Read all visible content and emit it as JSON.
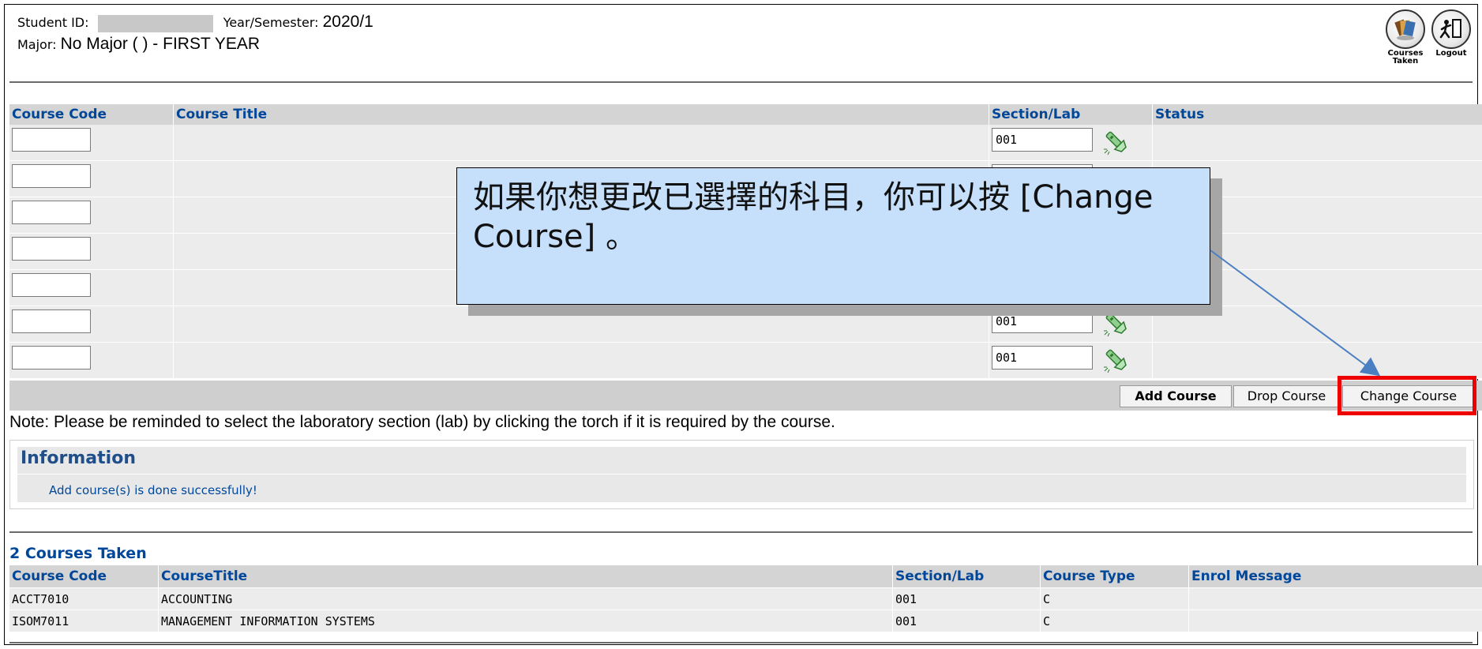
{
  "header": {
    "student_id_label": "Student ID:",
    "year_label": "Year/Semester:",
    "year_value": "2020/1",
    "major_label": "Major:",
    "major_value": "No Major ( ) - FIRST YEAR",
    "icons": [
      {
        "name": "courses-taken-icon",
        "caption": "Courses\nTaken"
      },
      {
        "name": "logout-icon",
        "caption": "Logout"
      }
    ]
  },
  "enrol_table": {
    "columns": [
      "Course Code",
      "Course Title",
      "Section/Lab",
      "Status"
    ],
    "rows": [
      {
        "code": "",
        "section": "001"
      },
      {
        "code": "",
        "section": ""
      },
      {
        "code": "",
        "section": ""
      },
      {
        "code": "",
        "section": ""
      },
      {
        "code": "",
        "section": ""
      },
      {
        "code": "",
        "section": "001"
      },
      {
        "code": "",
        "section": "001"
      }
    ]
  },
  "buttons": {
    "add": "Add Course",
    "drop": "Drop Course",
    "change": "Change Course"
  },
  "note": "Note: Please be reminded to select the laboratory section (lab) by clicking the torch if it is required by the course.",
  "info": {
    "title": "Information",
    "message": "Add course(s) is done successfully!"
  },
  "courses_taken": {
    "title": "2 Courses Taken",
    "columns": [
      "Course Code",
      "CourseTitle",
      "Section/Lab",
      "Course Type",
      "Enrol Message"
    ],
    "rows": [
      [
        "ACCT7010",
        "ACCOUNTING",
        "001",
        "C",
        ""
      ],
      [
        "ISOM7011",
        "MANAGEMENT INFORMATION SYSTEMS",
        "001",
        "C",
        ""
      ]
    ]
  },
  "callout": {
    "text": "如果你想更改已選擇的科目，你可以按 [Change Course] 。"
  },
  "colors": {
    "header_text": "#00479a",
    "highlight": "#ee0000",
    "callout_bg": "#c6dffb",
    "arrow": "#4a7fc1"
  }
}
